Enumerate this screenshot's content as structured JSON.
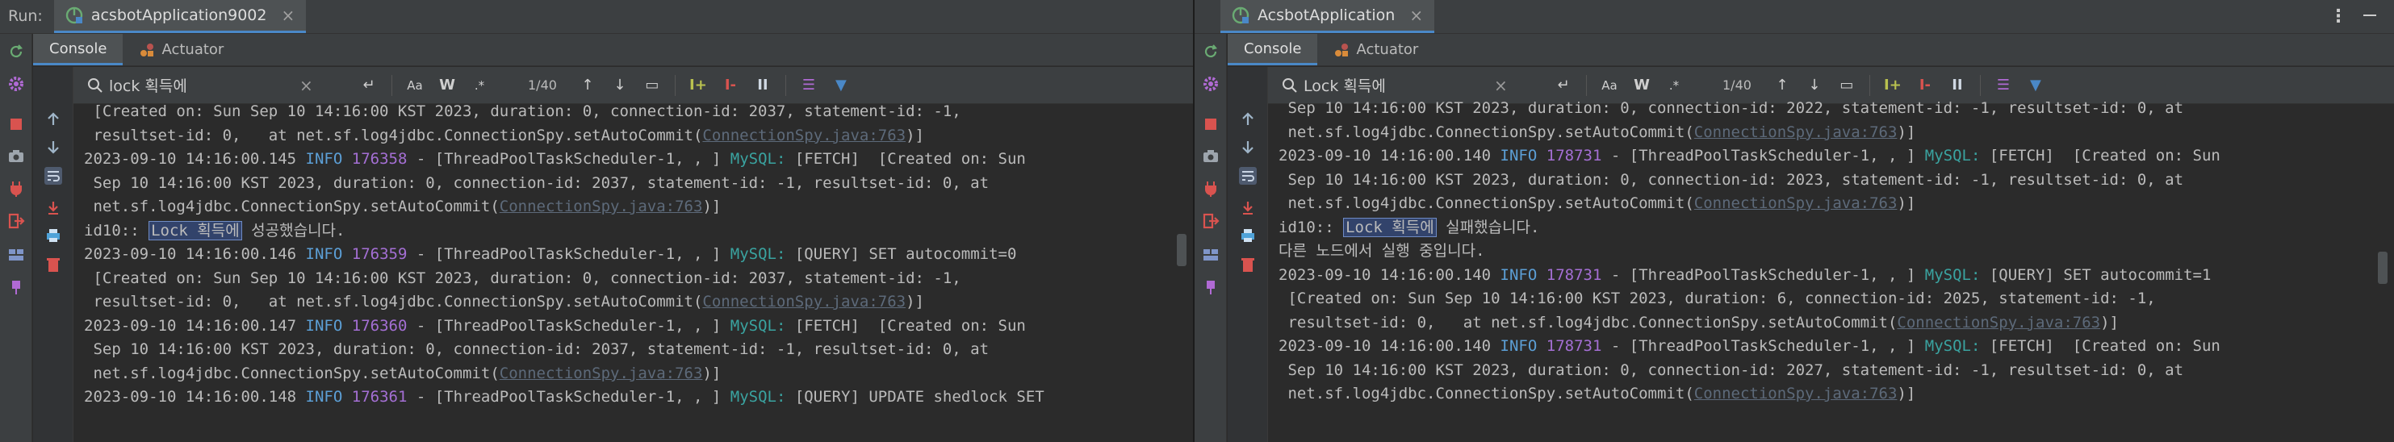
{
  "left": {
    "run_label": "Run:",
    "tab_title": "acsbotApplication9002",
    "subtabs": {
      "console": "Console",
      "actuator": "Actuator"
    },
    "search": {
      "value": "lock 획득에",
      "matches": "1/40"
    },
    "search_tools": {
      "match_case": "Aa",
      "words": "W",
      "regex": ".*"
    },
    "lines": [
      {
        "segs": [
          {
            "t": " [Created on: Sun Sep 10 14:16:00 KST 2023, duration: 0, connection-id: 2037, statement-id: -1,"
          }
        ]
      },
      {
        "segs": [
          {
            "t": " resultset-id: 0,   at net.sf.log4jdbc.ConnectionSpy.setAutoCommit("
          },
          {
            "t": "ConnectionSpy.java:763",
            "c": "link"
          },
          {
            "t": ")]"
          }
        ]
      },
      {
        "segs": [
          {
            "t": "2023-09-10 14:16:00.145 "
          },
          {
            "t": "INFO",
            "c": "info"
          },
          {
            "t": " "
          },
          {
            "t": "176358",
            "c": "tid"
          },
          {
            "t": " - [ThreadPoolTaskScheduler-1, , ] "
          },
          {
            "t": "MySQL:",
            "c": "mysql"
          },
          {
            "t": " [FETCH]  [Created on: Sun"
          }
        ]
      },
      {
        "segs": [
          {
            "t": " Sep 10 14:16:00 KST 2023, duration: 0, connection-id: 2037, statement-id: -1, resultset-id: 0, at"
          }
        ]
      },
      {
        "segs": [
          {
            "t": " net.sf.log4jdbc.ConnectionSpy.setAutoCommit("
          },
          {
            "t": "ConnectionSpy.java:763",
            "c": "link"
          },
          {
            "t": ")]"
          }
        ]
      },
      {
        "segs": [
          {
            "t": "id10:: "
          },
          {
            "t": "Lock 획득에",
            "c": "hl"
          },
          {
            "t": " 성공했습니다."
          }
        ]
      },
      {
        "segs": [
          {
            "t": "2023-09-10 14:16:00.146 "
          },
          {
            "t": "INFO",
            "c": "info"
          },
          {
            "t": " "
          },
          {
            "t": "176359",
            "c": "tid"
          },
          {
            "t": " - [ThreadPoolTaskScheduler-1, , ] "
          },
          {
            "t": "MySQL:",
            "c": "mysql"
          },
          {
            "t": " [QUERY] SET autocommit=0"
          }
        ]
      },
      {
        "segs": [
          {
            "t": " [Created on: Sun Sep 10 14:16:00 KST 2023, duration: 0, connection-id: 2037, statement-id: -1,"
          }
        ]
      },
      {
        "segs": [
          {
            "t": " resultset-id: 0,   at net.sf.log4jdbc.ConnectionSpy.setAutoCommit("
          },
          {
            "t": "ConnectionSpy.java:763",
            "c": "link"
          },
          {
            "t": ")]"
          }
        ]
      },
      {
        "segs": [
          {
            "t": "2023-09-10 14:16:00.147 "
          },
          {
            "t": "INFO",
            "c": "info"
          },
          {
            "t": " "
          },
          {
            "t": "176360",
            "c": "tid"
          },
          {
            "t": " - [ThreadPoolTaskScheduler-1, , ] "
          },
          {
            "t": "MySQL:",
            "c": "mysql"
          },
          {
            "t": " [FETCH]  [Created on: Sun"
          }
        ]
      },
      {
        "segs": [
          {
            "t": " Sep 10 14:16:00 KST 2023, duration: 0, connection-id: 2037, statement-id: -1, resultset-id: 0, at"
          }
        ]
      },
      {
        "segs": [
          {
            "t": " net.sf.log4jdbc.ConnectionSpy.setAutoCommit("
          },
          {
            "t": "ConnectionSpy.java:763",
            "c": "link"
          },
          {
            "t": ")]"
          }
        ]
      },
      {
        "segs": [
          {
            "t": "2023-09-10 14:16:00.148 "
          },
          {
            "t": "INFO",
            "c": "info"
          },
          {
            "t": " "
          },
          {
            "t": "176361",
            "c": "tid"
          },
          {
            "t": " - [ThreadPoolTaskScheduler-1, , ] "
          },
          {
            "t": "MySQL:",
            "c": "mysql"
          },
          {
            "t": " [QUERY] UPDATE shedlock SET"
          }
        ]
      }
    ]
  },
  "right": {
    "tab_title": "AcsbotApplication",
    "subtabs": {
      "console": "Console",
      "actuator": "Actuator"
    },
    "search": {
      "value": "Lock 획득에",
      "matches": "1/40"
    },
    "search_tools": {
      "match_case": "Aa",
      "words": "W",
      "regex": ".*"
    },
    "lines": [
      {
        "segs": [
          {
            "t": " Sep 10 14:16:00 KST 2023, duration: 0, connection-id: 2022, statement-id: -1, resultset-id: 0, at"
          }
        ]
      },
      {
        "segs": [
          {
            "t": " net.sf.log4jdbc.ConnectionSpy.setAutoCommit("
          },
          {
            "t": "ConnectionSpy.java:763",
            "c": "link"
          },
          {
            "t": ")]"
          }
        ]
      },
      {
        "segs": [
          {
            "t": "2023-09-10 14:16:00.140 "
          },
          {
            "t": "INFO",
            "c": "info"
          },
          {
            "t": " "
          },
          {
            "t": "178731",
            "c": "tid"
          },
          {
            "t": " - [ThreadPoolTaskScheduler-1, , ] "
          },
          {
            "t": "MySQL:",
            "c": "mysql"
          },
          {
            "t": " [FETCH]  [Created on: Sun"
          }
        ]
      },
      {
        "segs": [
          {
            "t": " Sep 10 14:16:00 KST 2023, duration: 0, connection-id: 2023, statement-id: -1, resultset-id: 0, at"
          }
        ]
      },
      {
        "segs": [
          {
            "t": " net.sf.log4jdbc.ConnectionSpy.setAutoCommit("
          },
          {
            "t": "ConnectionSpy.java:763",
            "c": "link"
          },
          {
            "t": ")]"
          }
        ]
      },
      {
        "segs": [
          {
            "t": "id10:: "
          },
          {
            "t": "Lock 획득에",
            "c": "hl"
          },
          {
            "t": " 실패했습니다."
          }
        ]
      },
      {
        "segs": [
          {
            "t": "다른 노드에서 실행 중입니다."
          }
        ]
      },
      {
        "segs": [
          {
            "t": "2023-09-10 14:16:00.140 "
          },
          {
            "t": "INFO",
            "c": "info"
          },
          {
            "t": " "
          },
          {
            "t": "178731",
            "c": "tid"
          },
          {
            "t": " - [ThreadPoolTaskScheduler-1, , ] "
          },
          {
            "t": "MySQL:",
            "c": "mysql"
          },
          {
            "t": " [QUERY] SET autocommit=1"
          }
        ]
      },
      {
        "segs": [
          {
            "t": " [Created on: Sun Sep 10 14:16:00 KST 2023, duration: 6, connection-id: 2025, statement-id: -1,"
          }
        ]
      },
      {
        "segs": [
          {
            "t": " resultset-id: 0,   at net.sf.log4jdbc.ConnectionSpy.setAutoCommit("
          },
          {
            "t": "ConnectionSpy.java:763",
            "c": "link"
          },
          {
            "t": ")]"
          }
        ]
      },
      {
        "segs": [
          {
            "t": "2023-09-10 14:16:00.140 "
          },
          {
            "t": "INFO",
            "c": "info"
          },
          {
            "t": " "
          },
          {
            "t": "178731",
            "c": "tid"
          },
          {
            "t": " - [ThreadPoolTaskScheduler-1, , ] "
          },
          {
            "t": "MySQL:",
            "c": "mysql"
          },
          {
            "t": " [FETCH]  [Created on: Sun"
          }
        ]
      },
      {
        "segs": [
          {
            "t": " Sep 10 14:16:00 KST 2023, duration: 0, connection-id: 2027, statement-id: -1, resultset-id: 0, at"
          }
        ]
      },
      {
        "segs": [
          {
            "t": " net.sf.log4jdbc.ConnectionSpy.setAutoCommit("
          },
          {
            "t": "ConnectionSpy.java:763",
            "c": "link"
          },
          {
            "t": ")]"
          }
        ]
      }
    ]
  },
  "colors": {
    "info": "#5c9fd6",
    "thread_id": "#a46fd4",
    "mysql": "#3aa3a0",
    "link": "#5d6a7a",
    "active_tab_underline": "#4a88c7",
    "spring_green": "#6aab73"
  }
}
